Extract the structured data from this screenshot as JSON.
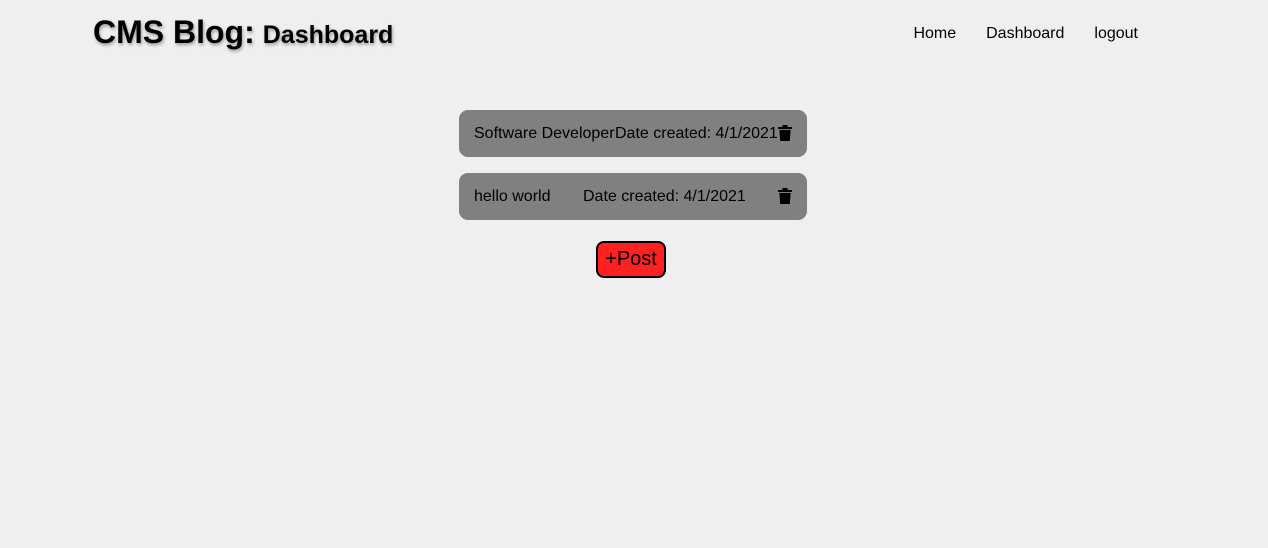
{
  "header": {
    "brand_main": "CMS Blog:",
    "brand_sub": "Dashboard"
  },
  "nav": {
    "items": [
      {
        "label": "Home"
      },
      {
        "label": "Dashboard"
      },
      {
        "label": "logout"
      }
    ]
  },
  "posts": [
    {
      "title": "Software Developer",
      "date": "Date created: 4/1/2021"
    },
    {
      "title": "hello world",
      "date": "Date created: 4/1/2021"
    }
  ],
  "actions": {
    "add_post_label": "+Post"
  },
  "colors": {
    "background": "#efefef",
    "post_card": "#808080",
    "add_post_button": "#ff2020"
  },
  "icons": {
    "delete": "trash-icon"
  }
}
